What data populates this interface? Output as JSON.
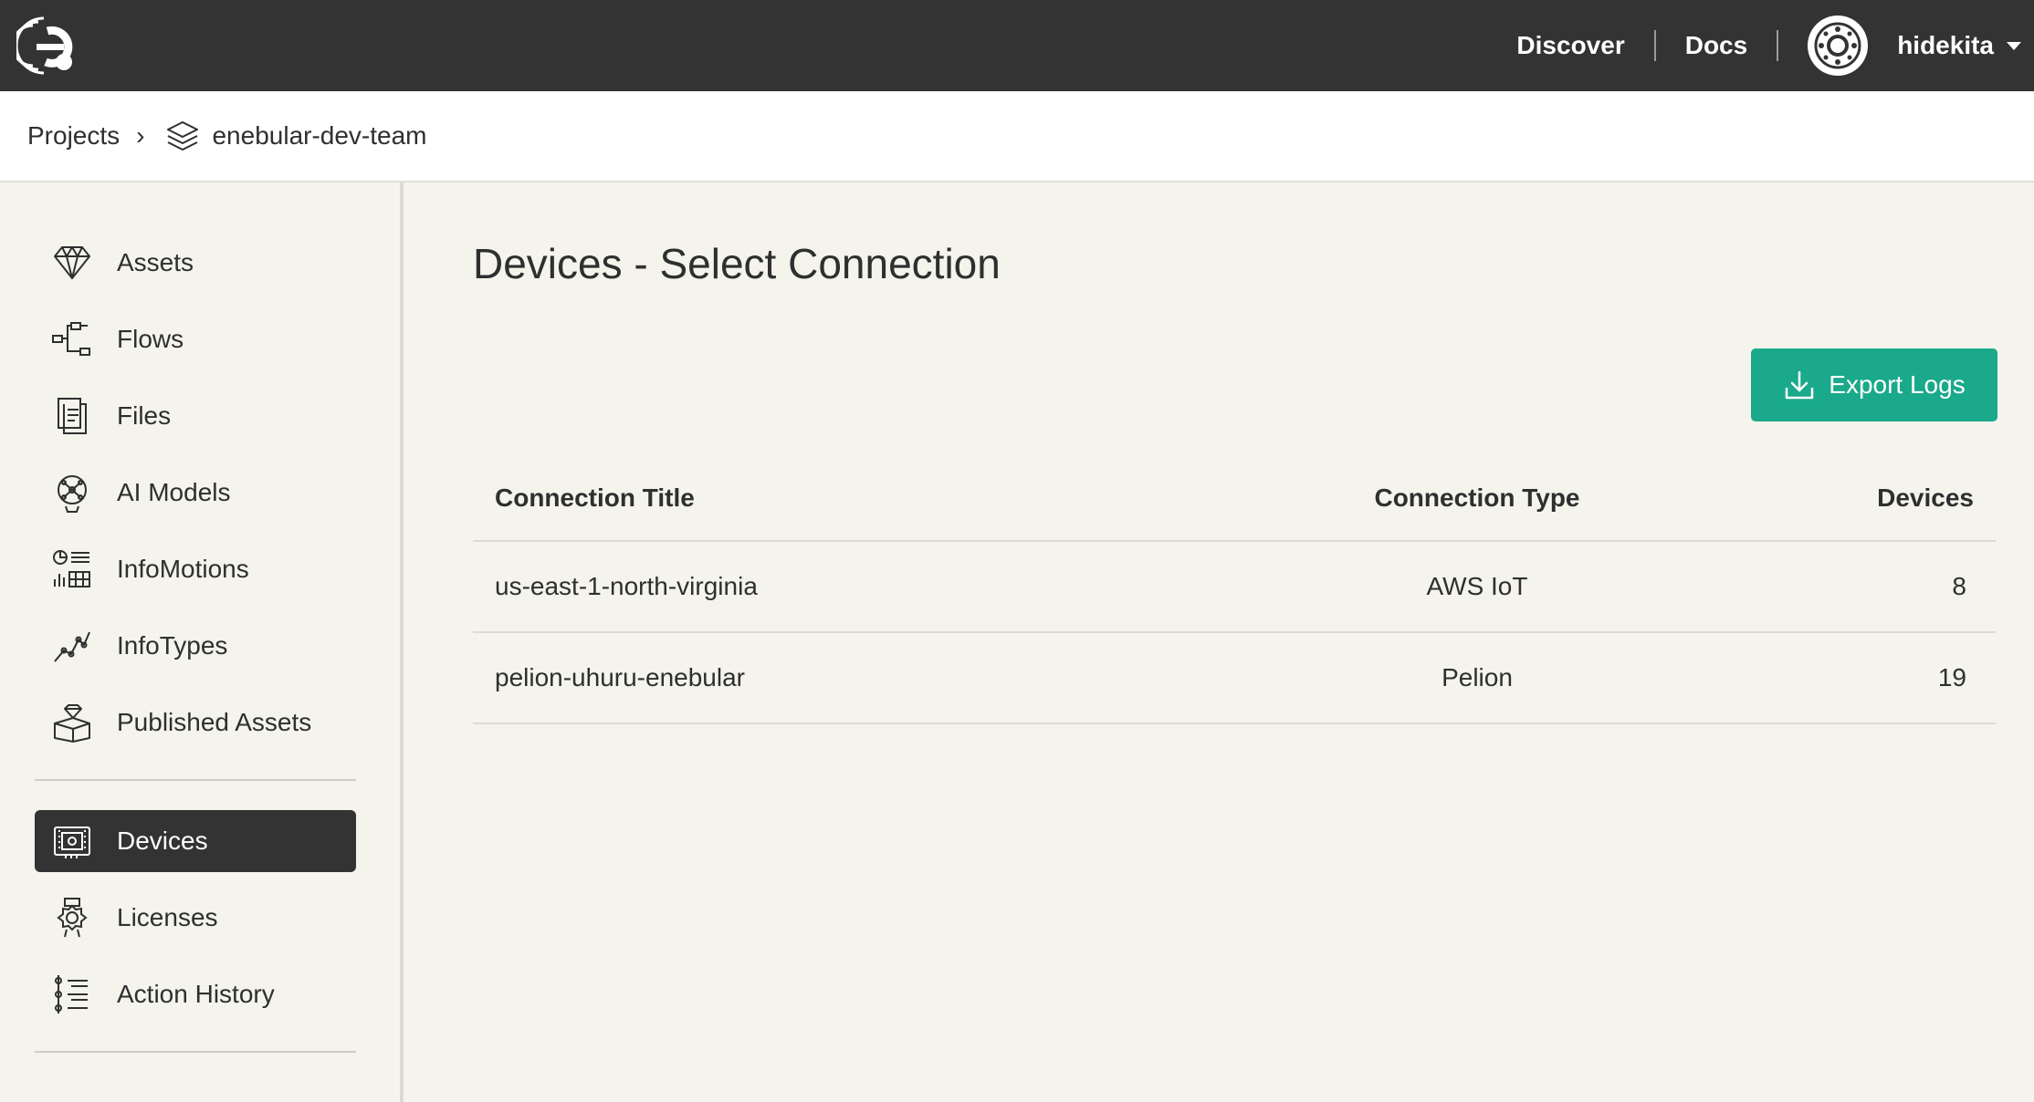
{
  "topbar": {
    "logo": "enebular-logo-icon",
    "nav": [
      {
        "label": "Discover"
      },
      {
        "label": "Docs"
      }
    ],
    "user": {
      "name": "hidekita",
      "avatar": "avatar-icon"
    }
  },
  "breadcrumb": {
    "root": "Projects",
    "separator": "›",
    "current": "enebular-dev-team",
    "current_icon": "layers-icon"
  },
  "sidebar": {
    "group1": [
      {
        "label": "Assets",
        "icon": "diamond-icon"
      },
      {
        "label": "Flows",
        "icon": "flow-icon"
      },
      {
        "label": "Files",
        "icon": "files-icon"
      },
      {
        "label": "AI Models",
        "icon": "ai-model-icon"
      },
      {
        "label": "InfoMotions",
        "icon": "infomotions-icon"
      },
      {
        "label": "InfoTypes",
        "icon": "infotypes-icon"
      },
      {
        "label": "Published Assets",
        "icon": "published-assets-icon"
      }
    ],
    "group2": [
      {
        "label": "Devices",
        "icon": "device-icon",
        "active": true
      },
      {
        "label": "Licenses",
        "icon": "license-icon"
      },
      {
        "label": "Action History",
        "icon": "action-history-icon"
      }
    ]
  },
  "main": {
    "title": "Devices - Select Connection",
    "export_label": "Export Logs",
    "table": {
      "headers": {
        "title": "Connection Title",
        "type": "Connection Type",
        "devices": "Devices"
      },
      "rows": [
        {
          "title": "us-east-1-north-virginia",
          "type": "AWS IoT",
          "devices": "8"
        },
        {
          "title": "pelion-uhuru-enebular",
          "type": "Pelion",
          "devices": "19"
        }
      ]
    }
  },
  "colors": {
    "topbar": "#333333",
    "accent": "#1aa98a",
    "background": "#f4f3ec"
  }
}
